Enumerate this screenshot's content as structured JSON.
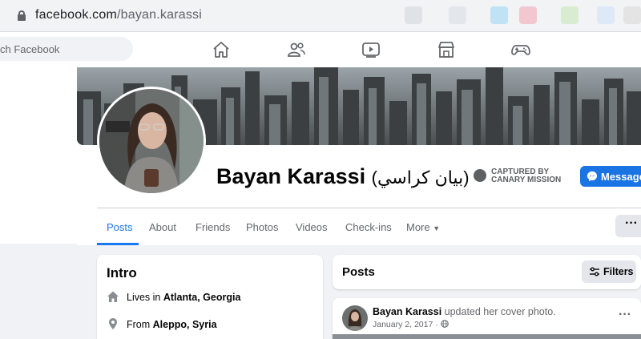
{
  "browser": {
    "url_domain": "facebook.com",
    "url_path": "/bayan.karassi"
  },
  "fb_nav": {
    "search_placeholder": "ch Facebook",
    "icons": [
      "home-icon",
      "friends-icon",
      "watch-icon",
      "marketplace-icon",
      "gaming-icon"
    ]
  },
  "profile": {
    "name": "Bayan Karassi",
    "arabic_name": "(بيان كراسي)",
    "watermark_line1": "CAPTURED BY",
    "watermark_line2": "CANARY MISSION",
    "message_button": "Message"
  },
  "tabs": [
    "Posts",
    "About",
    "Friends",
    "Photos",
    "Videos",
    "Check-ins",
    "More"
  ],
  "intro": {
    "title": "Intro",
    "lives_prefix": "Lives in ",
    "lives_value": "Atlanta, Georgia",
    "from_prefix": "From ",
    "from_value": "Aleppo, Syria"
  },
  "posts": {
    "title": "Posts",
    "filters_label": "Filters",
    "author": "Bayan Karassi",
    "action": " updated her cover photo.",
    "date": "January 2, 2017 · "
  },
  "colors": {
    "fb_blue": "#1877f2",
    "message_blue": "#1b74e4",
    "background": "#f0f2f5"
  }
}
